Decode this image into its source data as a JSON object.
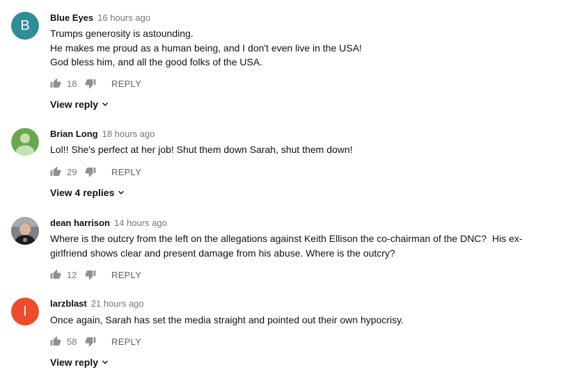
{
  "comments": [
    {
      "author": "Blue Eyes",
      "time": "16 hours ago",
      "avatar_letter": "B",
      "avatar_color": "#2e8d99",
      "lines": [
        "Trumps generosity is astounding.",
        "He makes me proud as a human being, and I don't even live in the USA!",
        "God bless him, and all the good folks of the USA."
      ],
      "likes": "18",
      "reply_label": "REPLY",
      "view_replies": "View reply"
    },
    {
      "author": "Brian Long",
      "time": "18 hours ago",
      "avatar_color": "#6aa84f",
      "lines": [
        "Lol!! She's perfect at her job! Shut them down Sarah, shut them down!"
      ],
      "likes": "29",
      "reply_label": "REPLY",
      "view_replies": "View 4 replies"
    },
    {
      "author": "dean harrison",
      "time": "14 hours ago",
      "lines": [
        "Where is the outcry from the left on the allegations against Keith Ellison the co-chairman of the DNC?  His ex-",
        "girlfriend shows clear and present damage from his abuse. Where is the outcry?"
      ],
      "likes": "12",
      "reply_label": "REPLY"
    },
    {
      "author": "larzblast",
      "time": "21 hours ago",
      "avatar_letter": "I",
      "avatar_color": "#ee4b2b",
      "lines": [
        "Once again, Sarah has set the media straight and pointed out their own hypocrisy."
      ],
      "likes": "58",
      "reply_label": "REPLY",
      "view_replies": "View reply"
    }
  ]
}
